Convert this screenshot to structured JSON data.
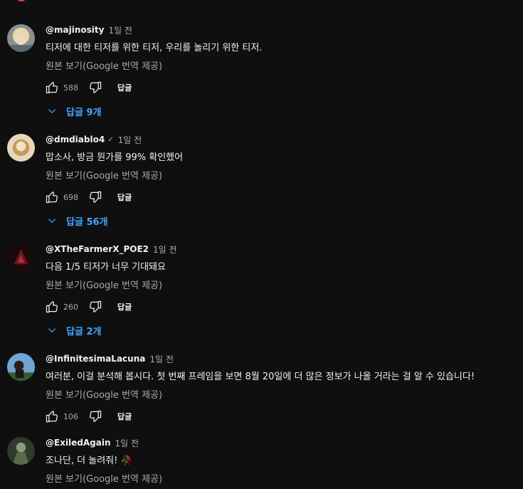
{
  "translate_label": "원본 보기(Google 번역 제공)",
  "reply_label": "답글",
  "comments": [
    {
      "author": "@majinosity",
      "time": "1일 전",
      "text": "티저에 대한 티저를 위한 티저, 우리를 놀리기 위한 티저.",
      "likes": "588",
      "replies": "답글 9개",
      "avatar": "blonde-avatar"
    },
    {
      "author": "@dmdiablo4",
      "verified": "✓",
      "time": "1일 전",
      "text": "맙소사, 방금 뭔가를 99% 확인했어",
      "likes": "698",
      "replies": "답글 56개",
      "avatar": "cream-avatar"
    },
    {
      "author": "@XTheFarmerX_POE2",
      "time": "1일 전",
      "text": "다음 1/5 티저가 너무 기대돼요",
      "likes": "260",
      "replies": "답글 2개",
      "avatar": "dark-red-avatar"
    },
    {
      "author": "@InfinitesimaLacuna",
      "time": "1일 전",
      "text": "여러분, 이걸 분석해 봅시다. 첫 번째 프레임을 보면 8월 20일에 더 많은 정보가 나올 거라는 걸 알 수 있습니다!",
      "likes": "106",
      "avatar": "sky-avatar"
    },
    {
      "author": "@ExiledAgain",
      "time": "1일 전",
      "text": "조나단, 더 놀려줘! 🥀",
      "avatar": "green-avatar"
    }
  ],
  "colors": {
    "background": "#0f0f0f",
    "text": "#f1f1f1",
    "secondary": "#aaaaaa",
    "link": "#3ea6ff"
  }
}
